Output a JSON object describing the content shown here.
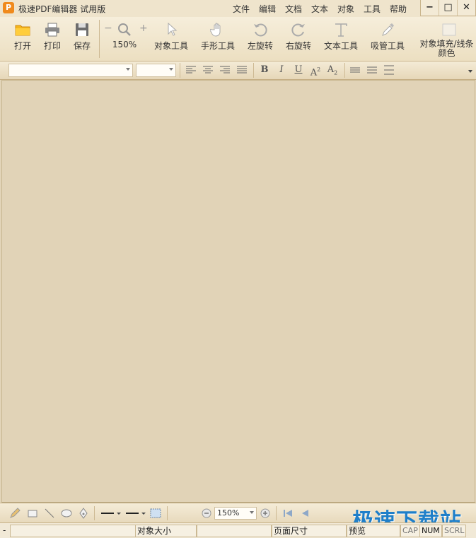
{
  "app": {
    "title": "极速PDF编辑器 试用版",
    "icon_letter": "P"
  },
  "menu": [
    "文件",
    "编辑",
    "文档",
    "文本",
    "对象",
    "工具",
    "帮助"
  ],
  "window_controls": {
    "minimize": "−",
    "maximize": "□",
    "close": "✕"
  },
  "toolbar": {
    "open": "打开",
    "print": "打印",
    "save": "保存",
    "zoom_minus": "−",
    "zoom_plus": "+",
    "zoom_value": "150%",
    "object_tool": "对象工具",
    "hand_tool": "手形工具",
    "rotate_left": "左旋转",
    "rotate_right": "右旋转",
    "text_tool": "文本工具",
    "eyedropper_tool": "吸管工具",
    "fill_line_color": "对象填充/线条颜色"
  },
  "format": {
    "font_name": "",
    "font_size": "",
    "bold": "B",
    "italic": "I",
    "underline": "U",
    "superscript": "A",
    "superscript_mark": "2",
    "subscript": "A",
    "subscript_mark": "2"
  },
  "drawbar": {
    "zoom_value": "150%"
  },
  "status": {
    "field1": "-",
    "object_size": "对象大小",
    "page_size": "页面尺寸",
    "preview": "预览",
    "cap": "CAP",
    "num": "NUM",
    "scrl": "SCRL"
  },
  "watermark": "极速下载站",
  "colors": {
    "accent": "#f08a1c",
    "canvas": "#e1d3b7",
    "watermark": "#1f7fc9"
  }
}
